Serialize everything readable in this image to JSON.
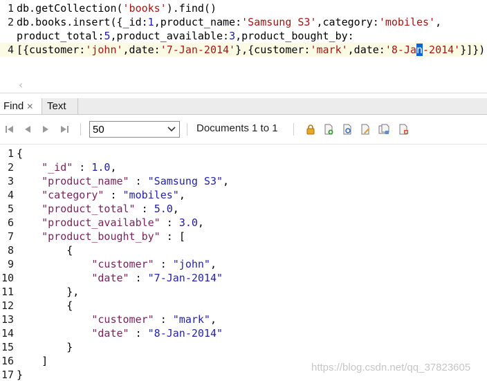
{
  "editor": {
    "lines": [
      {
        "no": "1",
        "parts": [
          {
            "t": "db.getCollection(",
            "c": ""
          },
          {
            "t": "'books'",
            "c": "str"
          },
          {
            "t": ").find()",
            "c": ""
          }
        ]
      },
      {
        "no": "2",
        "parts": [
          {
            "t": "db.books.insert({_id:",
            "c": ""
          },
          {
            "t": "1",
            "c": "num"
          },
          {
            "t": ",product_name:",
            "c": ""
          },
          {
            "t": "'Samsung S3'",
            "c": "str"
          },
          {
            "t": ",category:",
            "c": ""
          },
          {
            "t": "'mobiles'",
            "c": "str"
          },
          {
            "t": ",",
            "c": ""
          }
        ]
      },
      {
        "no": "",
        "parts": [
          {
            "t": "product_total:",
            "c": ""
          },
          {
            "t": "5",
            "c": "num"
          },
          {
            "t": ",product_available:",
            "c": ""
          },
          {
            "t": "3",
            "c": "num"
          },
          {
            "t": ",product_bought_by:",
            "c": ""
          }
        ]
      },
      {
        "no": "4",
        "current": true,
        "parts": [
          {
            "t": "[{customer:",
            "c": ""
          },
          {
            "t": "'john'",
            "c": "str"
          },
          {
            "t": ",date:",
            "c": ""
          },
          {
            "t": "'7-Jan-2014'",
            "c": "str"
          },
          {
            "t": "},{customer:",
            "c": ""
          },
          {
            "t": "'mark'",
            "c": "str"
          },
          {
            "t": ",date:",
            "c": ""
          },
          {
            "t": "'8-Ja",
            "c": "str"
          },
          {
            "t": "n",
            "c": "sel"
          },
          {
            "t": "-2014'",
            "c": "str"
          },
          {
            "t": "}]})",
            "c": ""
          }
        ]
      }
    ]
  },
  "tabs": {
    "find_label": "Find",
    "find_close": "✕",
    "text_label": "Text"
  },
  "toolbar": {
    "page_size": "50",
    "documents_label": "Documents 1 to 1"
  },
  "result": {
    "lines": [
      {
        "no": "1",
        "parts": [
          {
            "t": "{",
            "c": "punc"
          }
        ]
      },
      {
        "no": "2",
        "parts": [
          {
            "t": "    ",
            "c": ""
          },
          {
            "t": "\"_id\"",
            "c": "key"
          },
          {
            "t": " : ",
            "c": "punc"
          },
          {
            "t": "1.0",
            "c": "jnum"
          },
          {
            "t": ",",
            "c": "punc"
          }
        ]
      },
      {
        "no": "3",
        "parts": [
          {
            "t": "    ",
            "c": ""
          },
          {
            "t": "\"product_name\"",
            "c": "key"
          },
          {
            "t": " : ",
            "c": "punc"
          },
          {
            "t": "\"Samsung S3\"",
            "c": "jstr"
          },
          {
            "t": ",",
            "c": "punc"
          }
        ]
      },
      {
        "no": "4",
        "parts": [
          {
            "t": "    ",
            "c": ""
          },
          {
            "t": "\"category\"",
            "c": "key"
          },
          {
            "t": " : ",
            "c": "punc"
          },
          {
            "t": "\"mobiles\"",
            "c": "jstr"
          },
          {
            "t": ",",
            "c": "punc"
          }
        ]
      },
      {
        "no": "5",
        "parts": [
          {
            "t": "    ",
            "c": ""
          },
          {
            "t": "\"product_total\"",
            "c": "key"
          },
          {
            "t": " : ",
            "c": "punc"
          },
          {
            "t": "5.0",
            "c": "jnum"
          },
          {
            "t": ",",
            "c": "punc"
          }
        ]
      },
      {
        "no": "6",
        "parts": [
          {
            "t": "    ",
            "c": ""
          },
          {
            "t": "\"product_available\"",
            "c": "key"
          },
          {
            "t": " : ",
            "c": "punc"
          },
          {
            "t": "3.0",
            "c": "jnum"
          },
          {
            "t": ",",
            "c": "punc"
          }
        ]
      },
      {
        "no": "7",
        "parts": [
          {
            "t": "    ",
            "c": ""
          },
          {
            "t": "\"product_bought_by\"",
            "c": "key"
          },
          {
            "t": " : ",
            "c": "punc"
          },
          {
            "t": "[",
            "c": "punc"
          }
        ]
      },
      {
        "no": "8",
        "parts": [
          {
            "t": "        {",
            "c": "punc"
          }
        ]
      },
      {
        "no": "9",
        "parts": [
          {
            "t": "            ",
            "c": ""
          },
          {
            "t": "\"customer\"",
            "c": "key"
          },
          {
            "t": " : ",
            "c": "punc"
          },
          {
            "t": "\"john\"",
            "c": "jstr"
          },
          {
            "t": ",",
            "c": "punc"
          }
        ]
      },
      {
        "no": "10",
        "parts": [
          {
            "t": "            ",
            "c": ""
          },
          {
            "t": "\"date\"",
            "c": "key"
          },
          {
            "t": " : ",
            "c": "punc"
          },
          {
            "t": "\"7-Jan-2014\"",
            "c": "jstr"
          }
        ]
      },
      {
        "no": "11",
        "parts": [
          {
            "t": "        },",
            "c": "punc"
          }
        ]
      },
      {
        "no": "12",
        "parts": [
          {
            "t": "        {",
            "c": "punc"
          }
        ]
      },
      {
        "no": "13",
        "parts": [
          {
            "t": "            ",
            "c": ""
          },
          {
            "t": "\"customer\"",
            "c": "key"
          },
          {
            "t": " : ",
            "c": "punc"
          },
          {
            "t": "\"mark\"",
            "c": "jstr"
          },
          {
            "t": ",",
            "c": "punc"
          }
        ]
      },
      {
        "no": "14",
        "parts": [
          {
            "t": "            ",
            "c": ""
          },
          {
            "t": "\"date\"",
            "c": "key"
          },
          {
            "t": " : ",
            "c": "punc"
          },
          {
            "t": "\"8-Jan-2014\"",
            "c": "jstr"
          }
        ]
      },
      {
        "no": "15",
        "parts": [
          {
            "t": "        }",
            "c": "punc"
          }
        ]
      },
      {
        "no": "16",
        "parts": [
          {
            "t": "    ]",
            "c": "punc"
          }
        ]
      },
      {
        "no": "17",
        "parts": [
          {
            "t": "}",
            "c": "punc"
          }
        ]
      }
    ]
  },
  "watermark": "https://blog.csdn.net/qq_37823605",
  "colors": {
    "string": "#a31515",
    "number": "#1b1b9c",
    "json_key": "#7a1f5a",
    "json_string": "#2222aa",
    "selection": "#0a64d8",
    "current_line": "#fbfbe4"
  },
  "icons": [
    "first-page-icon",
    "prev-page-icon",
    "next-page-icon",
    "last-page-icon",
    "lock-icon",
    "add-document-icon",
    "view-document-icon",
    "edit-document-icon",
    "copy-document-icon",
    "delete-document-icon"
  ]
}
